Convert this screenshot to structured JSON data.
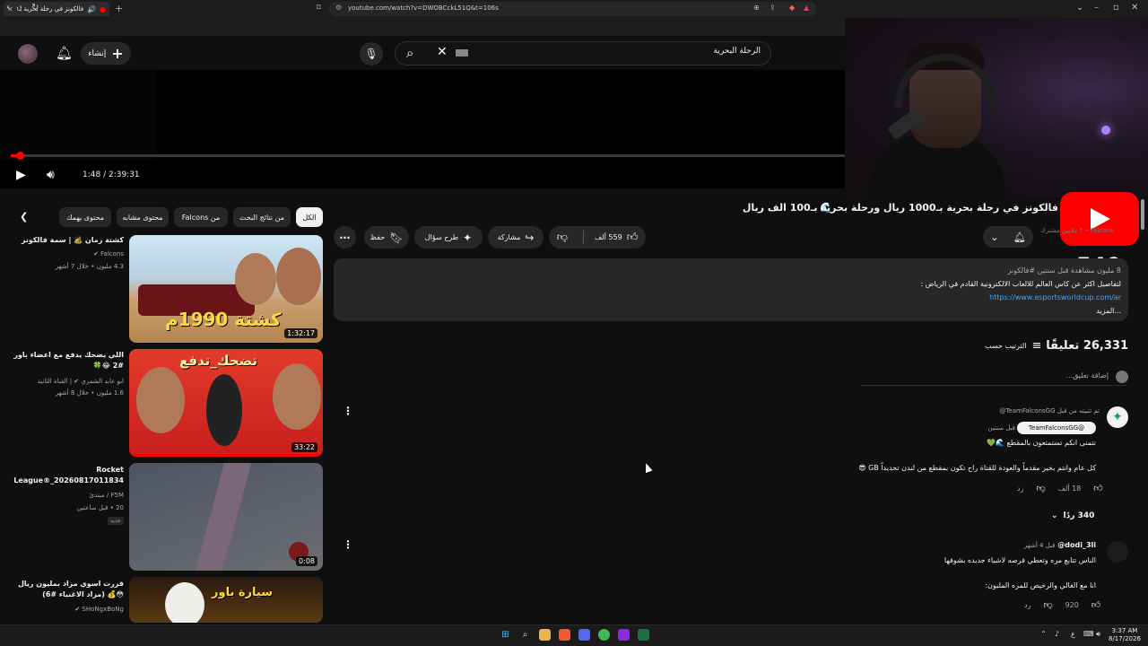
{
  "browser": {
    "tab_title": "فالكونز في رحلة بحرية بـ1000...",
    "address": "youtube.com/watch?v=DWOBCckL51Q&t=106s"
  },
  "header": {
    "create_label": "إنشاء",
    "search_query": "الرحلة البحرية"
  },
  "player": {
    "time": "1:48 / 2:39:31",
    "progress_fraction": 0.011
  },
  "overlay": {
    "subscriber_count": "540"
  },
  "video": {
    "title": "فالكونز في رحلة بحرية بـ1000 ريال ورحلة بحرية بـ100 الف ريال",
    "likes": "559 ألف",
    "share_label": "مشاركة",
    "ask_label": "طرح سؤال",
    "save_label": "حفظ",
    "channel_faded": "Falcons ‏• ٣ ملايين مشترك"
  },
  "description": {
    "meta": "8 مليون مشاهدة قبل سنتين #فالكونز",
    "line1": "لتفاصيل اكثر عن كاس العالم للالعاب الالكترونية القادم في الرياض :",
    "link": "https://www.esportsworldcup.com/ar",
    "more": "...المزيد"
  },
  "comments": {
    "count_label": "26,331 تعليقًا",
    "sort_label": "الترتيب حسب",
    "add_placeholder": "إضافة تعليق...",
    "c1": {
      "pinned": "تم تثبيته من قبل TeamFalconsGG@",
      "author": "TeamFalconsGG@",
      "time": "قبل سنتين",
      "line1": "نتمنى انكم تستمتعون بالمقطع 🌊💚",
      "line2": "كل عام وانتم بخير مقدماً والعودة للقناة راح تكون بمقطع من لندن تحديداً GB 😎",
      "likes": "18 ألف",
      "reply": "رد",
      "replies": "340 ردًا"
    },
    "c2": {
      "author": "dodi_3li@",
      "time": "قبل 4 أشهر",
      "line1": "الناس تتابع مره وتعطي فرصه لاشياء جديده بشوفها",
      "line2": "انا مع الغالي والرخيص للمره المليون:",
      "likes": "920",
      "reply": "رد"
    }
  },
  "chips": [
    "الكل",
    "من نتائج البحث",
    "من Falcons",
    "محتوى مشابه",
    "محتوى يهمك"
  ],
  "related": [
    {
      "title": "كشتة زمان 🏕️ | سمة فالكونز",
      "channel": "Falcons ✔",
      "meta": "4.3 مليون ‏• خلال 7 أشهر",
      "duration": "1:32:17",
      "overlay": "كشتة 1990م"
    },
    {
      "title": "اللي يضحك يدفع مع اعضاء باور #2 😂🍀",
      "channel": "ابو عابد الشمري ✔ | القناة الثانية",
      "meta": "1.6 مليون ‏• خلال 8 أشهر",
      "duration": "33:22",
      "overlay": "تضحك_تدفع"
    },
    {
      "title": "Rocket League®_20260817011834",
      "channel": "F5M / مبتدئ",
      "meta": "20 ‏• قبل ساعتين",
      "duration": "0:08",
      "badge": "جديد"
    },
    {
      "title": "قررت اسوي مزاد بمليون ريال 😳💰 (مزاد الاغنياء #6)",
      "channel": "SHoNgxBoNg ✔",
      "meta": "",
      "overlay": "سيارة باور"
    }
  ],
  "taskbar": {
    "time": "3:37 AM",
    "date": "8/17/2026",
    "lang": "ع"
  },
  "colors": {
    "accent_red": "#ff0000",
    "link_blue": "#3ea6ff",
    "surface": "#272727",
    "background": "#0f0f0f"
  },
  "icons": [
    "search-icon",
    "mic-icon",
    "bell-icon",
    "plus-icon",
    "play-icon",
    "volume-icon",
    "like-icon",
    "dislike-icon",
    "share-icon",
    "sparkle-icon",
    "bookmark-icon",
    "more-icon",
    "sort-icon",
    "chevron-down-icon",
    "chevron-left-icon",
    "youtube-logo"
  ]
}
